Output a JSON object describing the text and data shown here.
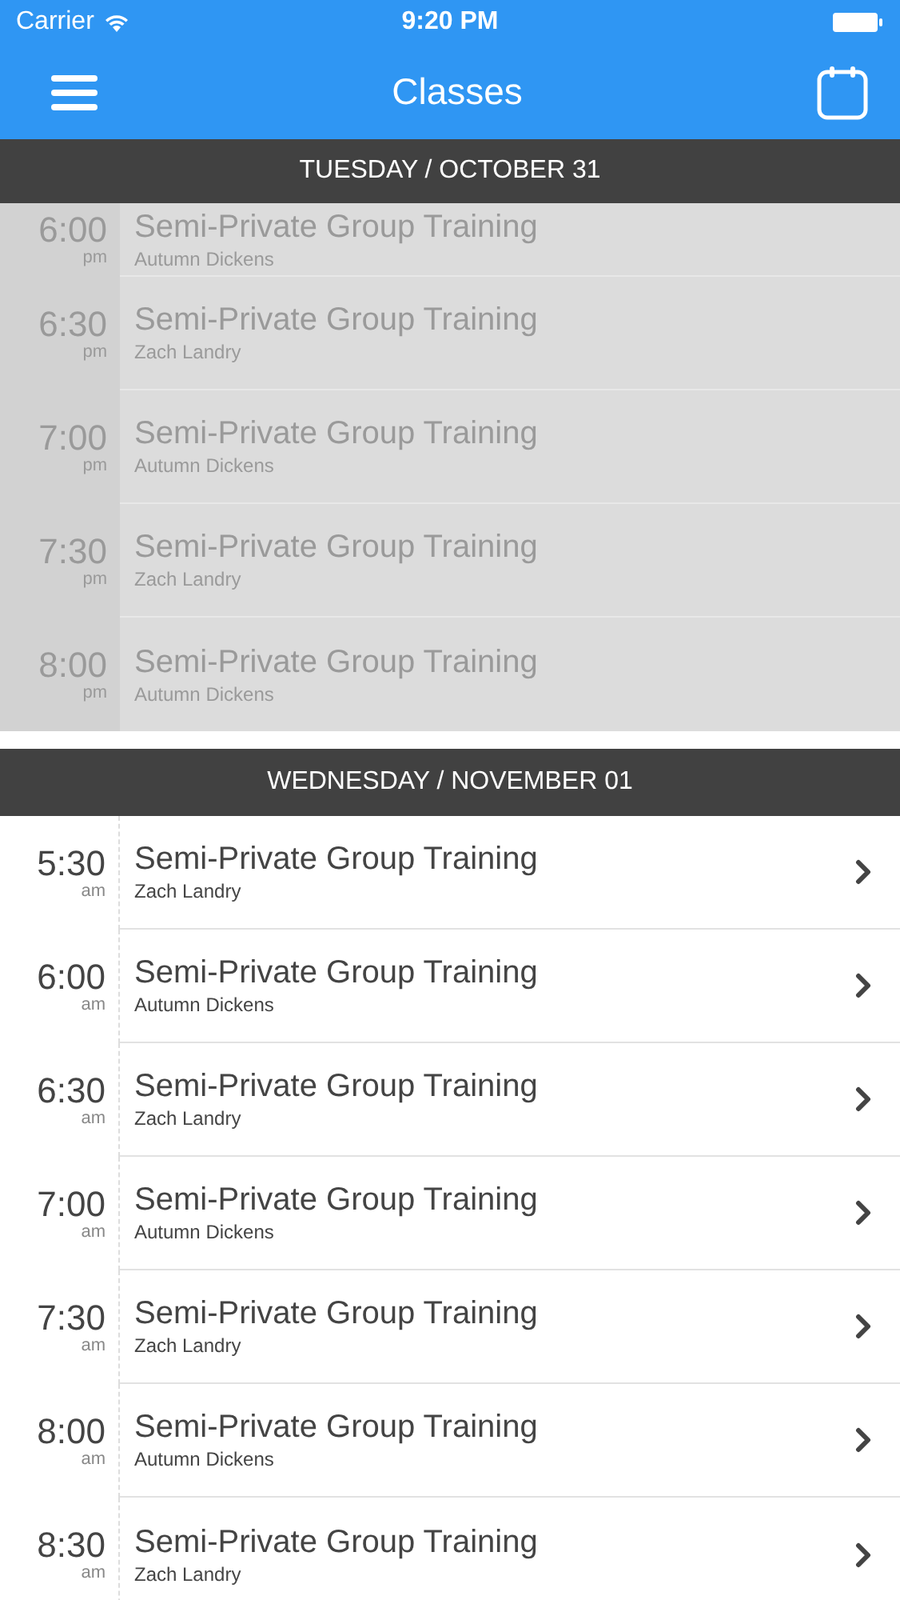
{
  "status_bar": {
    "carrier": "Carrier",
    "time": "9:20 PM"
  },
  "nav": {
    "title": "Classes"
  },
  "sections": [
    {
      "header": "TUESDAY / OCTOBER 31",
      "past": true,
      "rows": [
        {
          "time": "6:00",
          "period": "pm",
          "title": "Semi-Private Group Training",
          "instructor": "Autumn Dickens"
        },
        {
          "time": "6:30",
          "period": "pm",
          "title": "Semi-Private Group Training",
          "instructor": "Zach Landry"
        },
        {
          "time": "7:00",
          "period": "pm",
          "title": "Semi-Private Group Training",
          "instructor": "Autumn Dickens"
        },
        {
          "time": "7:30",
          "period": "pm",
          "title": "Semi-Private Group Training",
          "instructor": "Zach Landry"
        },
        {
          "time": "8:00",
          "period": "pm",
          "title": "Semi-Private Group Training",
          "instructor": "Autumn Dickens"
        }
      ]
    },
    {
      "header": "WEDNESDAY / NOVEMBER 01",
      "past": false,
      "rows": [
        {
          "time": "5:30",
          "period": "am",
          "title": "Semi-Private Group Training",
          "instructor": "Zach Landry"
        },
        {
          "time": "6:00",
          "period": "am",
          "title": "Semi-Private Group Training",
          "instructor": "Autumn Dickens"
        },
        {
          "time": "6:30",
          "period": "am",
          "title": "Semi-Private Group Training",
          "instructor": "Zach Landry"
        },
        {
          "time": "7:00",
          "period": "am",
          "title": "Semi-Private Group Training",
          "instructor": "Autumn Dickens"
        },
        {
          "time": "7:30",
          "period": "am",
          "title": "Semi-Private Group Training",
          "instructor": "Zach Landry"
        },
        {
          "time": "8:00",
          "period": "am",
          "title": "Semi-Private Group Training",
          "instructor": "Autumn Dickens"
        },
        {
          "time": "8:30",
          "period": "am",
          "title": "Semi-Private Group Training",
          "instructor": "Zach Landry"
        }
      ]
    }
  ]
}
